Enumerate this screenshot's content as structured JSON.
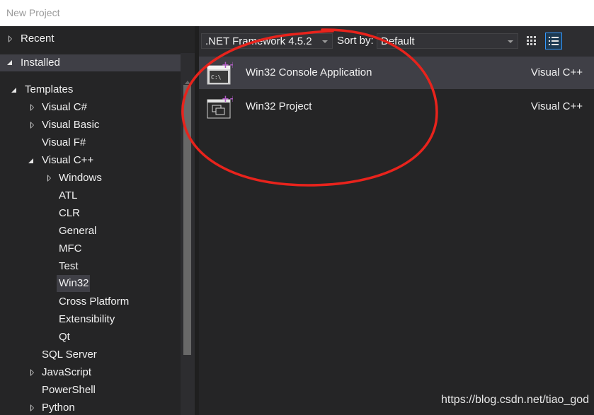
{
  "window": {
    "title": "New Project"
  },
  "tree": {
    "recent": "Recent",
    "installed": "Installed",
    "templates": "Templates",
    "visual_csharp": "Visual C#",
    "visual_basic": "Visual Basic",
    "visual_fsharp": "Visual F#",
    "visual_cpp": "Visual C++",
    "cpp_children": [
      "Windows",
      "ATL",
      "CLR",
      "General",
      "MFC",
      "Test",
      "Win32",
      "Cross Platform",
      "Extensibility",
      "Qt"
    ],
    "sql_server": "SQL Server",
    "javascript": "JavaScript",
    "powershell": "PowerShell",
    "python": "Python"
  },
  "toolbar": {
    "framework": ".NET Framework 4.5.2",
    "sort_label": "Sort by:",
    "sort_value": "Default"
  },
  "templates": [
    {
      "name": "Win32 Console Application",
      "language": "Visual C++",
      "icon": "console-app-icon"
    },
    {
      "name": "Win32 Project",
      "language": "Visual C++",
      "icon": "win32-project-icon"
    }
  ],
  "watermark": "https://blog.csdn.net/tiao_god",
  "colors": {
    "background": "#252526",
    "selection": "#3f3f46",
    "annotation": "#e8231c",
    "accent": "#3399ff"
  }
}
